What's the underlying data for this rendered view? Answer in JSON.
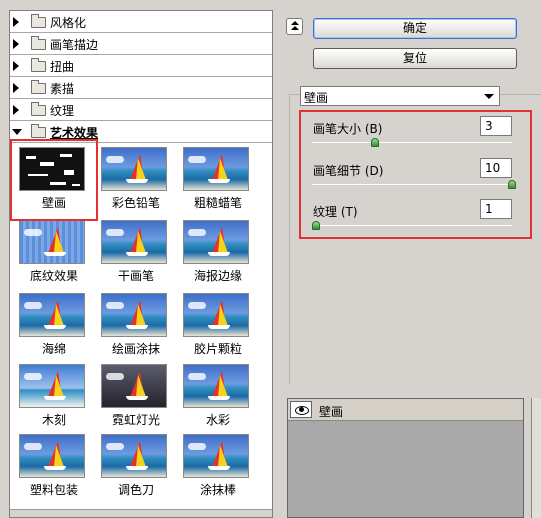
{
  "categories": [
    {
      "label": "风格化",
      "open": false
    },
    {
      "label": "画笔描边",
      "open": false
    },
    {
      "label": "扭曲",
      "open": false
    },
    {
      "label": "素描",
      "open": false
    },
    {
      "label": "纹理",
      "open": false
    },
    {
      "label": "艺术效果",
      "open": true
    }
  ],
  "filters": [
    {
      "label": "壁画",
      "selected": true
    },
    {
      "label": "彩色铅笔"
    },
    {
      "label": "粗糙蜡笔"
    },
    {
      "label": "底纹效果"
    },
    {
      "label": "干画笔"
    },
    {
      "label": "海报边缘"
    },
    {
      "label": "海绵"
    },
    {
      "label": "绘画涂抹"
    },
    {
      "label": "胶片颗粒"
    },
    {
      "label": "木刻"
    },
    {
      "label": "霓虹灯光"
    },
    {
      "label": "水彩"
    },
    {
      "label": "塑料包装"
    },
    {
      "label": "调色刀"
    },
    {
      "label": "涂抹棒"
    }
  ],
  "buttons": {
    "ok": "确定",
    "reset": "复位"
  },
  "filter_select": {
    "value": "壁画"
  },
  "params": [
    {
      "label": "画笔大小 (B)",
      "value": "3",
      "fraction": 0.3
    },
    {
      "label": "画笔细节 (D)",
      "value": "10",
      "fraction": 1.0
    },
    {
      "label": "纹理 (T)",
      "value": "1",
      "fraction": 0.0
    }
  ],
  "preview": {
    "layer_label": "壁画"
  },
  "colors": {
    "highlight": "#e03232",
    "knob": "#2f8c33"
  }
}
